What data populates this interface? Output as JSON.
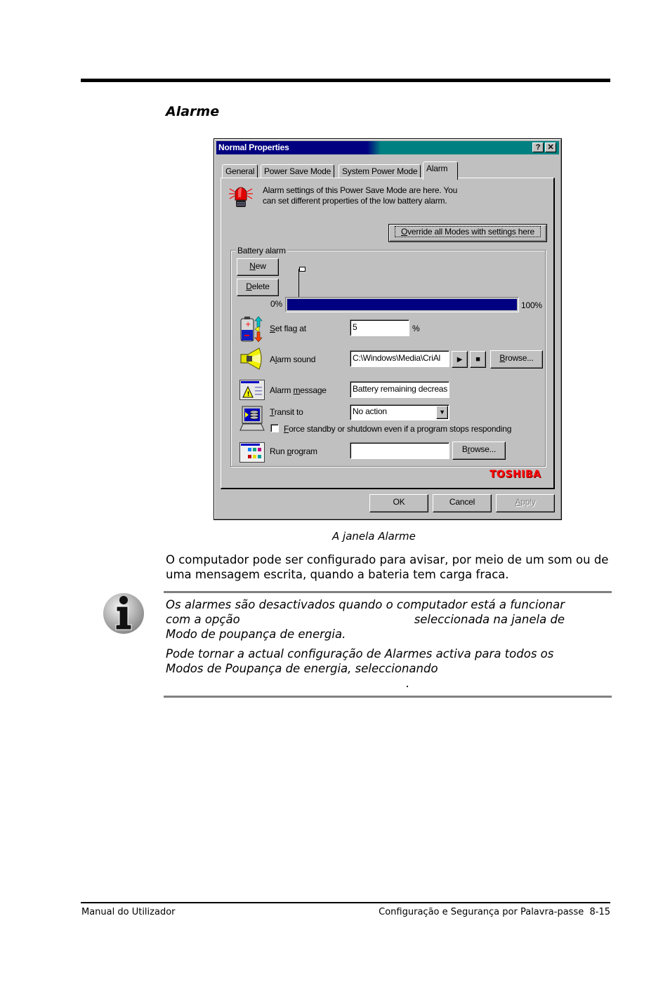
{
  "page": {
    "section_title": "Alarme",
    "caption": "A janela Alarme",
    "body_text": "O computador pode ser configurado para avisar, por meio de um som ou de uma mensagem escrita, quando a bateria tem carga fraca.",
    "note": {
      "icon": "info-icon",
      "para1_line1": "Os alarmes são desactivados quando o computador está a funcionar",
      "para1_line2_a": "com a opção",
      "para1_line2_b": "seleccionada na janela de",
      "para1_line3": "Modo de poupança de energia.",
      "para2_line1": "Pode tornar a actual configuração de Alarmes activa para todos os",
      "para2_line2": "Modos de Poupança de energia, seleccionando",
      "para2_line3": "."
    },
    "footer": {
      "left": "Manual do Utilizador",
      "right": "Configuração e Segurança por Palavra-passe  8-15"
    }
  },
  "dialog": {
    "title": "Normal Properties",
    "help_button": "?",
    "close_button": "✕",
    "tabs": [
      {
        "label": "General",
        "active": false
      },
      {
        "label": "Power Save Mode",
        "active": false
      },
      {
        "label": "System Power Mode",
        "active": false
      },
      {
        "label": "Alarm",
        "active": true
      }
    ],
    "intro_line1": "Alarm settings of this Power Save Mode are here. You",
    "intro_line2": "can set different properties of the low battery alarm.",
    "override_button": {
      "mnemonic": "O",
      "rest": "verride all Modes with settings here"
    },
    "battery_alarm": {
      "group_label": "Battery alarm",
      "new_button": {
        "mnemonic": "N",
        "rest": "ew"
      },
      "delete_button": {
        "mnemonic": "D",
        "rest": "elete"
      },
      "scale_min": "0%",
      "scale_max": "100%",
      "flag_position_percent": 5,
      "set_flag": {
        "mnemonic": "S",
        "rest": "et flag at",
        "value": "5",
        "unit": "%"
      },
      "alarm_sound": {
        "pre": "A",
        "mnemonic": "l",
        "rest": "arm sound",
        "value": "C:\\Windows\\Media\\CriAl",
        "play": "▶",
        "stop": "■",
        "browse_mnemonic": "B",
        "browse_rest": "rowse..."
      },
      "alarm_message": {
        "pre": "Alarm ",
        "mnemonic": "m",
        "rest": "essage",
        "value": "Battery remaining decreas"
      },
      "transit_to": {
        "mnemonic": "T",
        "rest": "ransit to",
        "value": "No action"
      },
      "force_standby": {
        "mnemonic": "F",
        "rest": "orce standby or shutdown even if a program stops responding",
        "checked": false
      },
      "run_program": {
        "pre": "Run ",
        "mnemonic": "p",
        "rest": "rogram",
        "value": "",
        "browse_pre": "B",
        "browse_mnemonic": "r",
        "browse_rest": "owse..."
      }
    },
    "brand": "TOSHIBA",
    "ok_button": "OK",
    "cancel_button": "Cancel",
    "apply_button": {
      "mnemonic": "A",
      "rest": "pply",
      "enabled": false
    },
    "colors": {
      "title_active": "#000080",
      "title_gradient_end": "#008080",
      "face": "#c0c0c0",
      "level_fill": "#000080",
      "brand": "#ff0000"
    }
  }
}
